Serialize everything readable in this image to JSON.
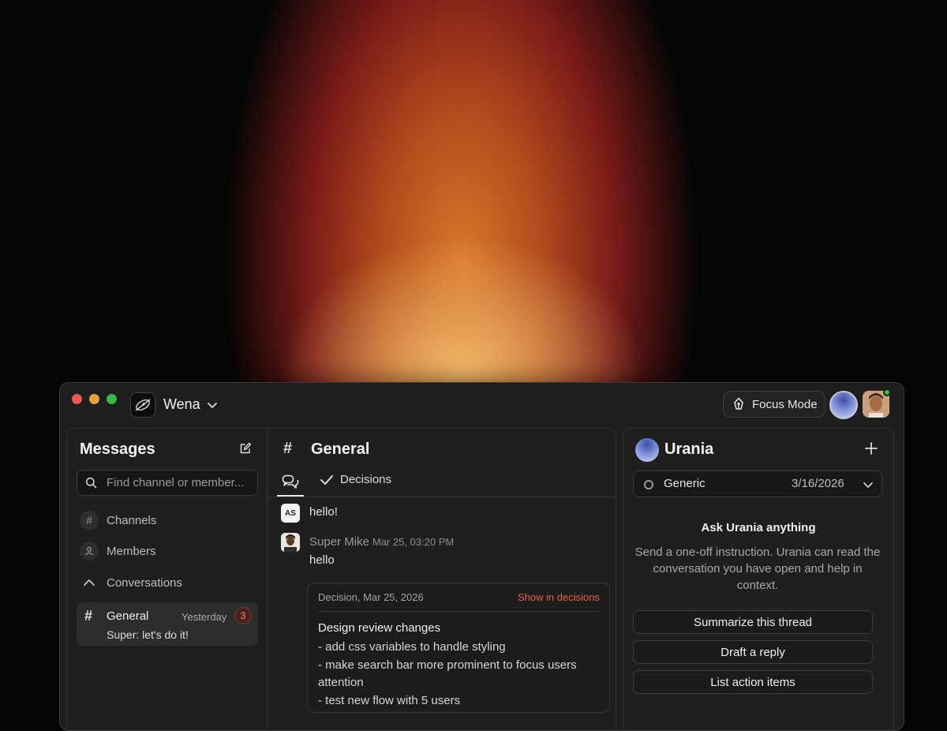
{
  "app": {
    "name": "Wena"
  },
  "header": {
    "focus_mode_label": "Focus Mode"
  },
  "sidebar": {
    "title": "Messages",
    "search_placeholder": "Find channel or member...",
    "nav": [
      {
        "label": "Channels",
        "icon": "hash-icon"
      },
      {
        "label": "Members",
        "icon": "user-icon"
      }
    ],
    "conversations_label": "Conversations",
    "conversations": [
      {
        "name": "General",
        "time": "Yesterday",
        "unread": "3",
        "preview": "Super: let's do it!"
      }
    ]
  },
  "channel": {
    "title": "General",
    "tabs": [
      {
        "label": "",
        "icon": "chat-bubbles-icon"
      },
      {
        "label": "Decisions",
        "icon": "check-icon"
      }
    ],
    "messages": [
      {
        "avatar_initials": "AS",
        "author": "",
        "time": "",
        "text": "hello!"
      },
      {
        "avatar_initials": "",
        "author": "Super Mike",
        "time": "Mar 25, 03:20 PM",
        "text": "hello"
      }
    ],
    "decision": {
      "meta": "Decision, Mar 25, 2026",
      "link": "Show in decisions",
      "title": "Design review changes",
      "items": [
        "- add css variables to handle styling",
        "- make search bar more prominent to focus users attention",
        "- test new flow with 5 users"
      ]
    }
  },
  "assistant": {
    "name": "Urania",
    "context": {
      "label": "Generic",
      "date": "3/16/2026"
    },
    "ask_title": "Ask Urania anything",
    "ask_description": "Send a one-off instruction. Urania can read the conversation you have open and help in context.",
    "actions": [
      "Summarize this thread",
      "Draft a reply",
      "List action items"
    ]
  },
  "colors": {
    "accent": "#e5673d",
    "badge_text": "#f08b6a",
    "online": "#2fbf4a",
    "window_bg": "#1e1e1e",
    "glow_core": "#f6be6e",
    "glow_outer": "#7a1b18"
  }
}
